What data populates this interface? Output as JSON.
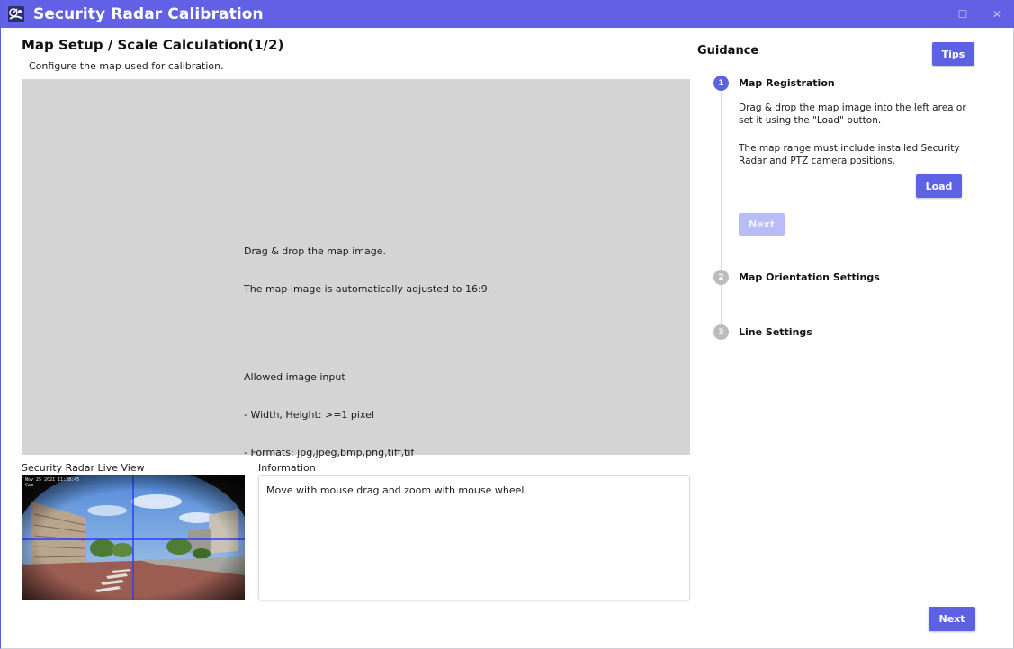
{
  "window": {
    "title": "Security Radar Calibration",
    "accent_color": "#6261e6",
    "icon": "radar-app-icon",
    "maximize_glyph": "☐",
    "close_glyph": "✕"
  },
  "page": {
    "title": "Map Setup / Scale Calculation(1/2)",
    "subtitle": "Configure the map used for calibration."
  },
  "drop_area": {
    "line1": "Drag & drop the map image.",
    "line2": "The map image is automatically adjusted to 16:9.",
    "line3": "Allowed image input",
    "line4": "- Width, Height: >=1 pixel",
    "line5": "- Formats: jpg,jpeg,bmp,png,tiff,tif",
    "background_color": "#d4d4d4"
  },
  "live_view": {
    "label": "Security Radar Live View",
    "overlay_line1": "Nov 25 2021 11:28:45",
    "overlay_line2": "Cam"
  },
  "information": {
    "label": "Information",
    "text": "Move with mouse drag and zoom with mouse wheel."
  },
  "guidance": {
    "title": "Guidance",
    "tips_label": "Tips",
    "steps": [
      {
        "number": "1",
        "title": "Map Registration",
        "desc1": "Drag & drop the map image into the left area or set it using the \"Load\" button.",
        "desc2": "The map range must include installed Security Radar and PTZ camera positions.",
        "load_label": "Load",
        "next_label": "Next"
      },
      {
        "number": "2",
        "title": "Map Orientation Settings"
      },
      {
        "number": "3",
        "title": "Line Settings"
      }
    ]
  },
  "footer": {
    "next_label": "Next"
  }
}
